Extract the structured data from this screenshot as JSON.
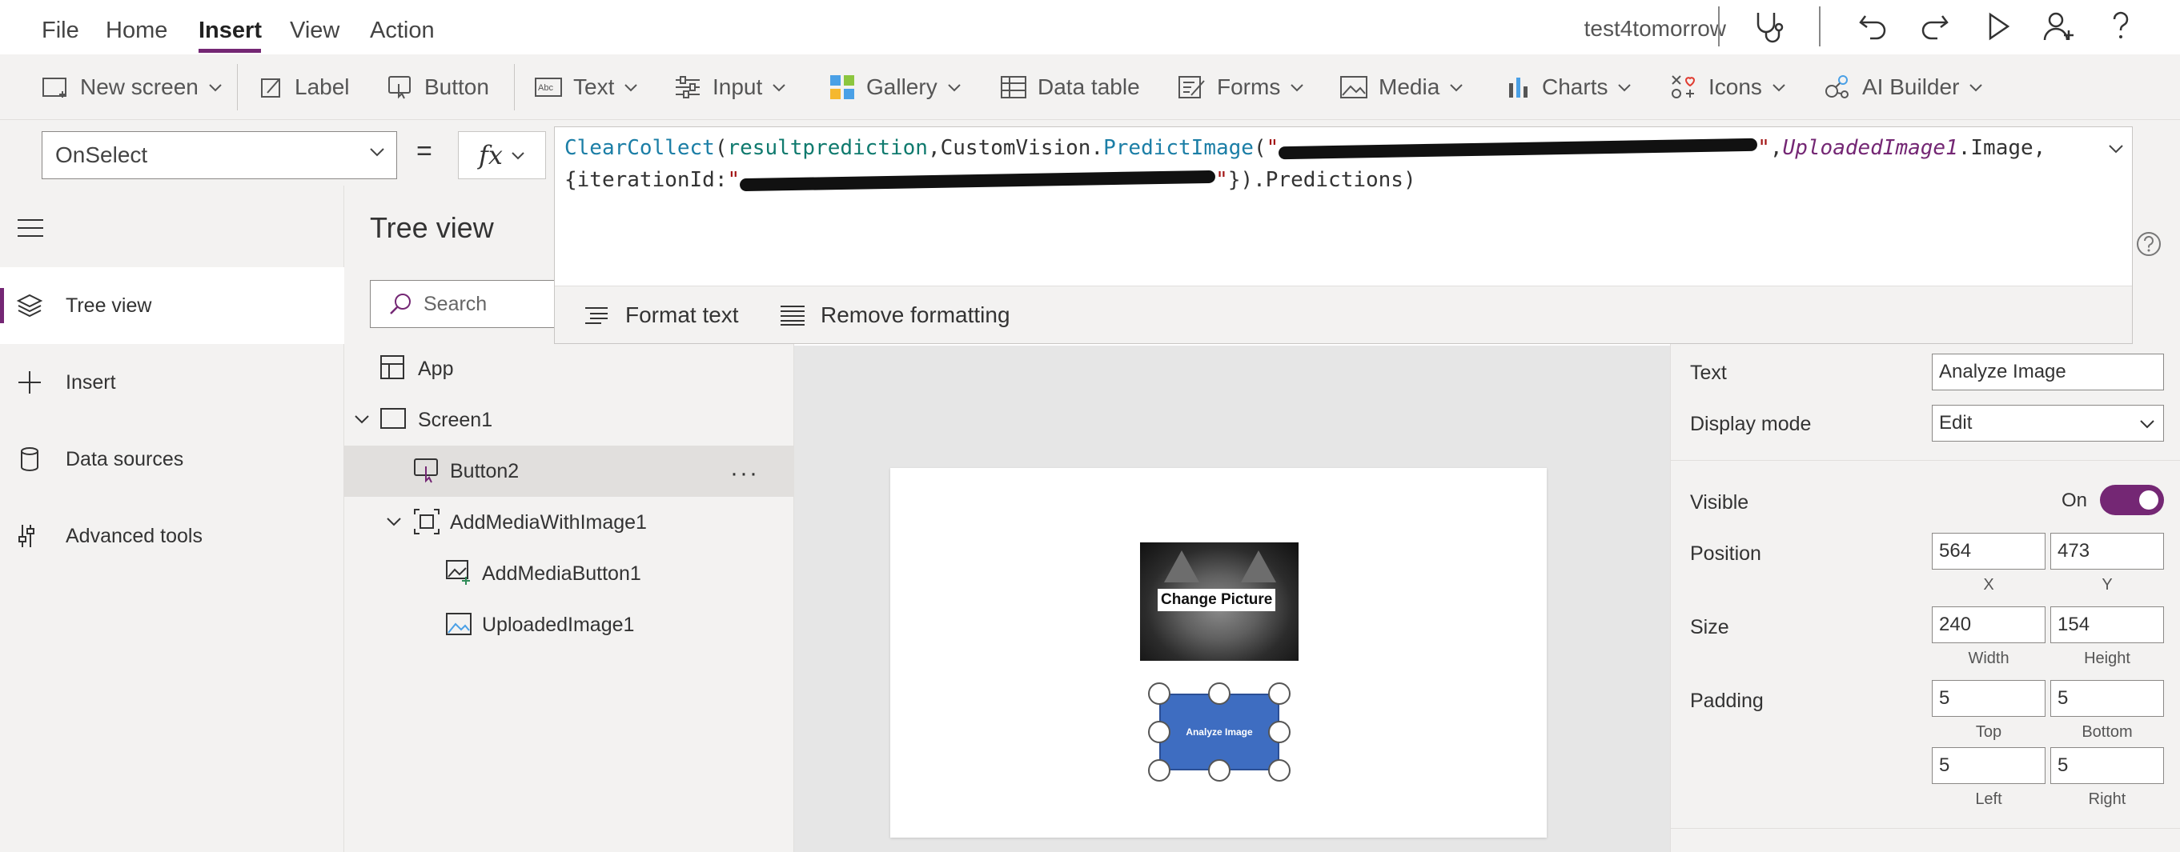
{
  "menu": {
    "items": [
      {
        "label": "File"
      },
      {
        "label": "Home"
      },
      {
        "label": "Insert"
      },
      {
        "label": "View"
      },
      {
        "label": "Action"
      }
    ],
    "active": "Insert",
    "app_name": "test4tomorrow"
  },
  "ribbon": {
    "new_screen": "New screen",
    "label": "Label",
    "button": "Button",
    "text": "Text",
    "input": "Input",
    "gallery": "Gallery",
    "data_table": "Data table",
    "forms": "Forms",
    "media": "Media",
    "charts": "Charts",
    "icons": "Icons",
    "ai_builder": "AI Builder"
  },
  "formula_bar": {
    "property": "OnSelect",
    "equals": "=",
    "fx": "fx",
    "line1": {
      "fn1": "ClearCollect",
      "p1": "(",
      "var1": "resultprediction",
      "p2": ",CustomVision.",
      "fn2": "PredictImage",
      "p3": "(",
      "str1_q1": "\"",
      "str1_q2": "\"",
      "p4": ",",
      "ctl1": "UploadedImage1",
      "p5": ".Image,"
    },
    "line2": {
      "p1": "{iterationId:",
      "str2_q1": "\"",
      "str2_q2": "\"",
      "p2": "}).Predictions)"
    },
    "format_text": "Format text",
    "remove_formatting": "Remove formatting"
  },
  "left_nav": {
    "items": [
      {
        "label": "Tree view"
      },
      {
        "label": "Insert"
      },
      {
        "label": "Data sources"
      },
      {
        "label": "Advanced tools"
      }
    ]
  },
  "tree_view": {
    "title": "Tree view",
    "search_placeholder": "Search",
    "nodes": [
      {
        "label": "App"
      },
      {
        "label": "Screen1"
      },
      {
        "label": "Button2"
      },
      {
        "label": "AddMediaWithImage1"
      },
      {
        "label": "AddMediaButton1"
      },
      {
        "label": "UploadedImage1"
      }
    ],
    "more": "···"
  },
  "canvas": {
    "change_picture": "Change Picture",
    "button_text": "Analyze Image"
  },
  "properties": {
    "text_label": "Text",
    "text_value": "Analyze Image",
    "display_mode_label": "Display mode",
    "display_mode_value": "Edit",
    "visible_label": "Visible",
    "visible_state": "On",
    "position_label": "Position",
    "position_x": "564",
    "position_y": "473",
    "x_label": "X",
    "y_label": "Y",
    "size_label": "Size",
    "size_width": "240",
    "size_height": "154",
    "width_label": "Width",
    "height_label": "Height",
    "padding_label": "Padding",
    "padding_top": "5",
    "padding_bottom": "5",
    "padding_left": "5",
    "padding_right": "5",
    "top_label": "Top",
    "bottom_label": "Bottom",
    "left_label": "Left",
    "right_label": "Right"
  },
  "colors": {
    "accent": "#742774",
    "button_fill": "#3e6dc1",
    "formula_function": "#1b7ea6",
    "formula_string": "#a31515"
  }
}
